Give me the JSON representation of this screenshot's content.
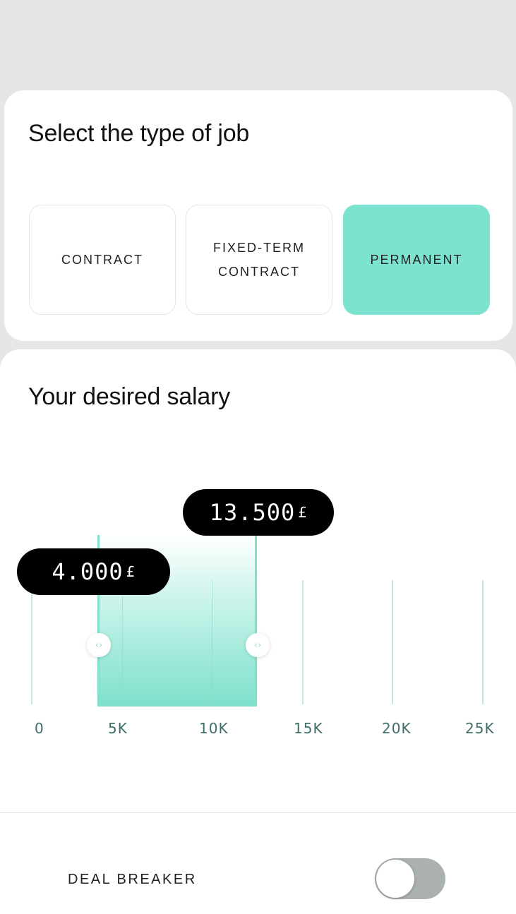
{
  "job_type": {
    "title": "Select the type of job",
    "options": [
      {
        "label": "CONTRACT",
        "selected": false
      },
      {
        "label": "FIXED-TERM CONTRACT",
        "line1": "FIXED-TERM",
        "line2": "CONTRACT",
        "selected": false
      },
      {
        "label": "PERMANENT",
        "selected": true
      }
    ]
  },
  "salary": {
    "title": "Your desired salary",
    "min_value": "4.000",
    "max_value": "13.500",
    "currency": "£",
    "axis_ticks": [
      "0",
      "5K",
      "10K",
      "15K",
      "20K",
      "25K"
    ]
  },
  "deal_breaker": {
    "label": "DEAL BREAKER",
    "enabled": false
  },
  "colors": {
    "accent": "#7de3d1",
    "bubble": "#000000",
    "toggle_off": "#aab1ae"
  }
}
